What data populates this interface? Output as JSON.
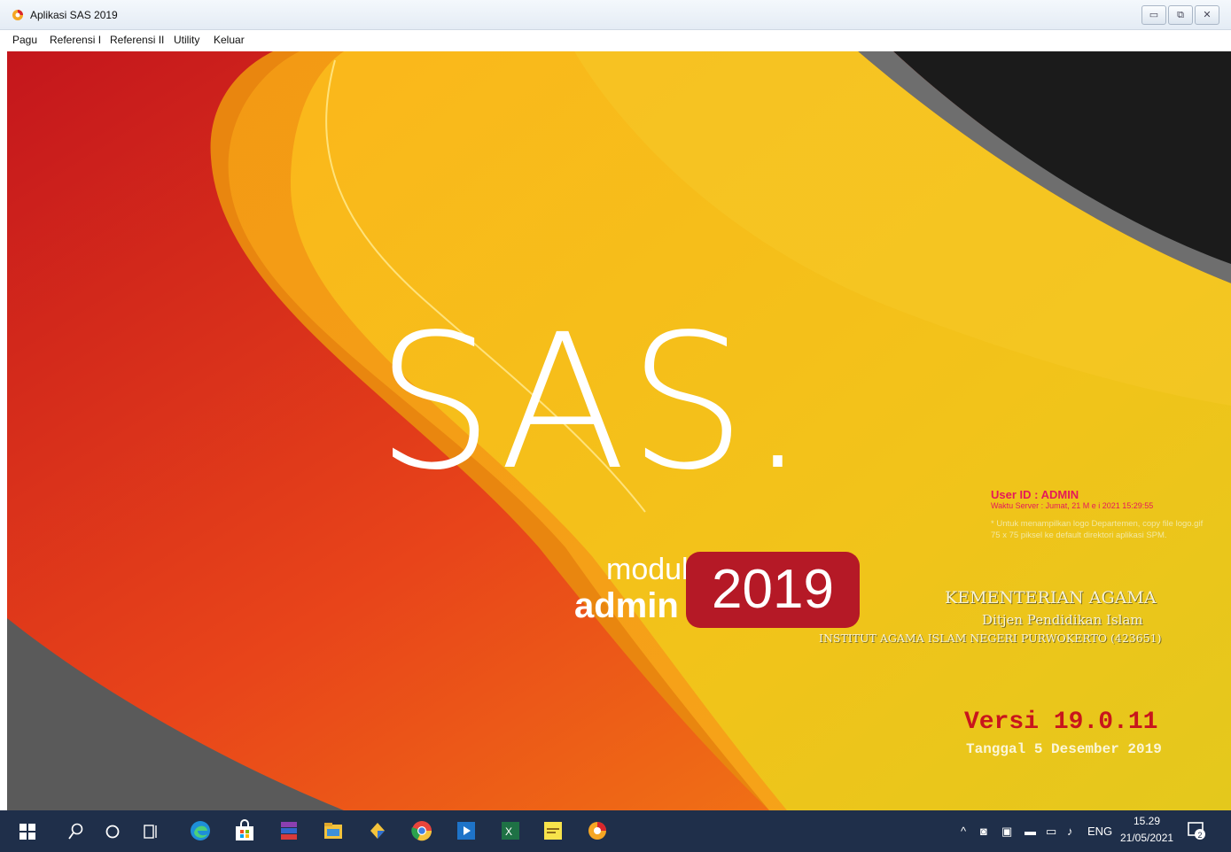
{
  "window": {
    "title": "Aplikasi SAS 2019",
    "min": "▭",
    "max": "⧉",
    "close": "✕"
  },
  "menu": [
    "Pagu",
    "Referensi I",
    "Referensi II",
    "Utility",
    "Keluar"
  ],
  "splash": {
    "logo": "SAS.",
    "modul": "modul",
    "admin": "admin",
    "year": "2019",
    "user_id": "User ID : ADMIN",
    "server_time": "Waktu Server : Jumat, 21 M e i 2021 15:29:55",
    "logo_note": "* Untuk menampilkan logo Departemen, copy file logo.gif 75 x 75 piksel ke default direktori aplikasi SPM.",
    "kementerian": "KEMENTERIAN AGAMA",
    "ditjen": "Ditjen Pendidikan Islam",
    "institusi": "INSTITUT AGAMA ISLAM NEGERI PURWOKERTO (423651)",
    "version": "Versi 19.0.11",
    "release_date": "Tanggal 5 Desember 2019"
  },
  "taskbar": {
    "icons": [
      "start-icon",
      "search-icon",
      "cortana-icon",
      "task-view-icon",
      "edge-icon",
      "store-icon",
      "winrar-icon",
      "file-explorer-icon",
      "folder-icon",
      "chrome-icon",
      "media-player-icon",
      "excel-icon",
      "sticky-notes-icon",
      "sas-app-icon"
    ],
    "tray_lang": "ENG",
    "time": "15.29",
    "date": "21/05/2021",
    "notification_count": "2"
  },
  "colors": {
    "accent_red": "#b51926",
    "yellow": "#f0c21b",
    "orange": "#f26a10",
    "dark": "#1b1b1b"
  }
}
